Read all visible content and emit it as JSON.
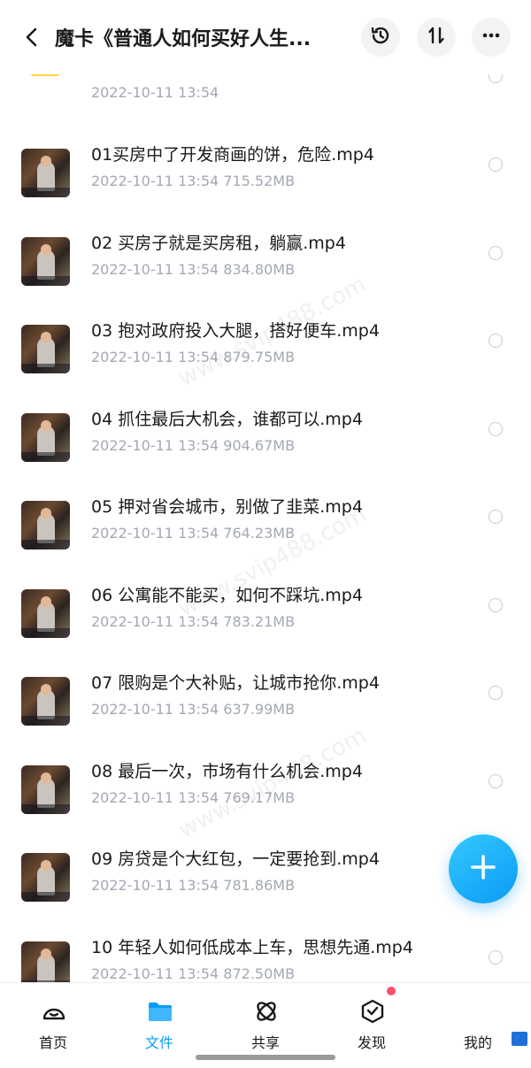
{
  "header": {
    "title": "魔卡《普通人如何买好人生...",
    "back_icon": "chevron-left-icon",
    "history_icon": "history-icon",
    "sort_icon": "sort-icon",
    "more_icon": "more-icon"
  },
  "files": [
    {
      "name": "",
      "date": "2022-10-11",
      "time": "13:54",
      "size": "",
      "type": "folder"
    },
    {
      "name": "01买房中了开发商画的饼，危险.mp4",
      "date": "2022-10-11",
      "time": "13:54",
      "size": "715.52MB",
      "type": "video"
    },
    {
      "name": "02 买房子就是买房租，躺赢.mp4",
      "date": "2022-10-11",
      "time": "13:54",
      "size": "834.80MB",
      "type": "video"
    },
    {
      "name": "03 抱对政府投入大腿，搭好便车.mp4",
      "date": "2022-10-11",
      "time": "13:54",
      "size": "879.75MB",
      "type": "video"
    },
    {
      "name": "04 抓住最后大机会，谁都可以.mp4",
      "date": "2022-10-11",
      "time": "13:54",
      "size": "904.67MB",
      "type": "video"
    },
    {
      "name": "05 押对省会城市，别做了韭菜.mp4",
      "date": "2022-10-11",
      "time": "13:54",
      "size": "764.23MB",
      "type": "video"
    },
    {
      "name": "06 公寓能不能买，如何不踩坑.mp4",
      "date": "2022-10-11",
      "time": "13:54",
      "size": "783.21MB",
      "type": "video"
    },
    {
      "name": "07 限购是个大补贴，让城市抢你.mp4",
      "date": "2022-10-11",
      "time": "13:54",
      "size": "637.99MB",
      "type": "video"
    },
    {
      "name": "08 最后一次，市场有什么机会.mp4",
      "date": "2022-10-11",
      "time": "13:54",
      "size": "769.17MB",
      "type": "video"
    },
    {
      "name": "09 房贷是个大红包，一定要抢到.mp4",
      "date": "2022-10-11",
      "time": "13:54",
      "size": "781.86MB",
      "type": "video"
    },
    {
      "name": "10 年轻人如何低成本上车，思想先通.mp4",
      "date": "2022-10-11",
      "time": "13:54",
      "size": "872.50MB",
      "type": "video"
    }
  ],
  "fab": {
    "icon": "plus-icon"
  },
  "tabs": [
    {
      "label": "首页",
      "icon": "home-icon",
      "active": false
    },
    {
      "label": "文件",
      "icon": "folder-icon",
      "active": true
    },
    {
      "label": "共享",
      "icon": "share-icon",
      "active": false
    },
    {
      "label": "发现",
      "icon": "discover-icon",
      "active": false
    },
    {
      "label": "我的",
      "icon": "profile-icon",
      "active": false
    }
  ],
  "watermark": "www.svip488.com",
  "colors": {
    "accent": "#0a9bf5",
    "badge": "#ff4d6a",
    "meta": "#a3a8b3"
  }
}
